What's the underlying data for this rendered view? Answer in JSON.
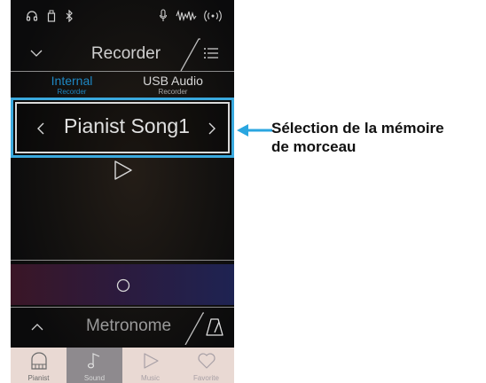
{
  "status_bar": {
    "icons": [
      "headphones-icon",
      "usb-memory-icon",
      "bluetooth-icon",
      "microphone-icon",
      "audio-waveform-icon",
      "wireless-icon"
    ]
  },
  "recorder": {
    "title": "Recorder",
    "tabs": [
      {
        "label": "Internal",
        "sub": "Recorder",
        "active": true
      },
      {
        "label": "USB Audio",
        "sub": "Recorder",
        "active": false
      }
    ],
    "song_name": "Pianist Song1"
  },
  "metronome": {
    "title": "Metronome"
  },
  "bottom_nav": [
    {
      "label": "Pianist",
      "icon": "piano-icon",
      "active": false
    },
    {
      "label": "Sound",
      "icon": "music-note-icon",
      "active": true
    },
    {
      "label": "Music",
      "icon": "play-icon",
      "active": false
    },
    {
      "label": "Favorite",
      "icon": "heart-icon",
      "active": false
    }
  ],
  "annotation": {
    "line1": "Sélection de la mémoire",
    "line2": "de morceau"
  },
  "colors": {
    "accent_blue": "#1e87c3",
    "highlight_border": "#3aa9de",
    "nav_bg": "#e9d9d3",
    "nav_active_bg": "#8e8a8e"
  }
}
